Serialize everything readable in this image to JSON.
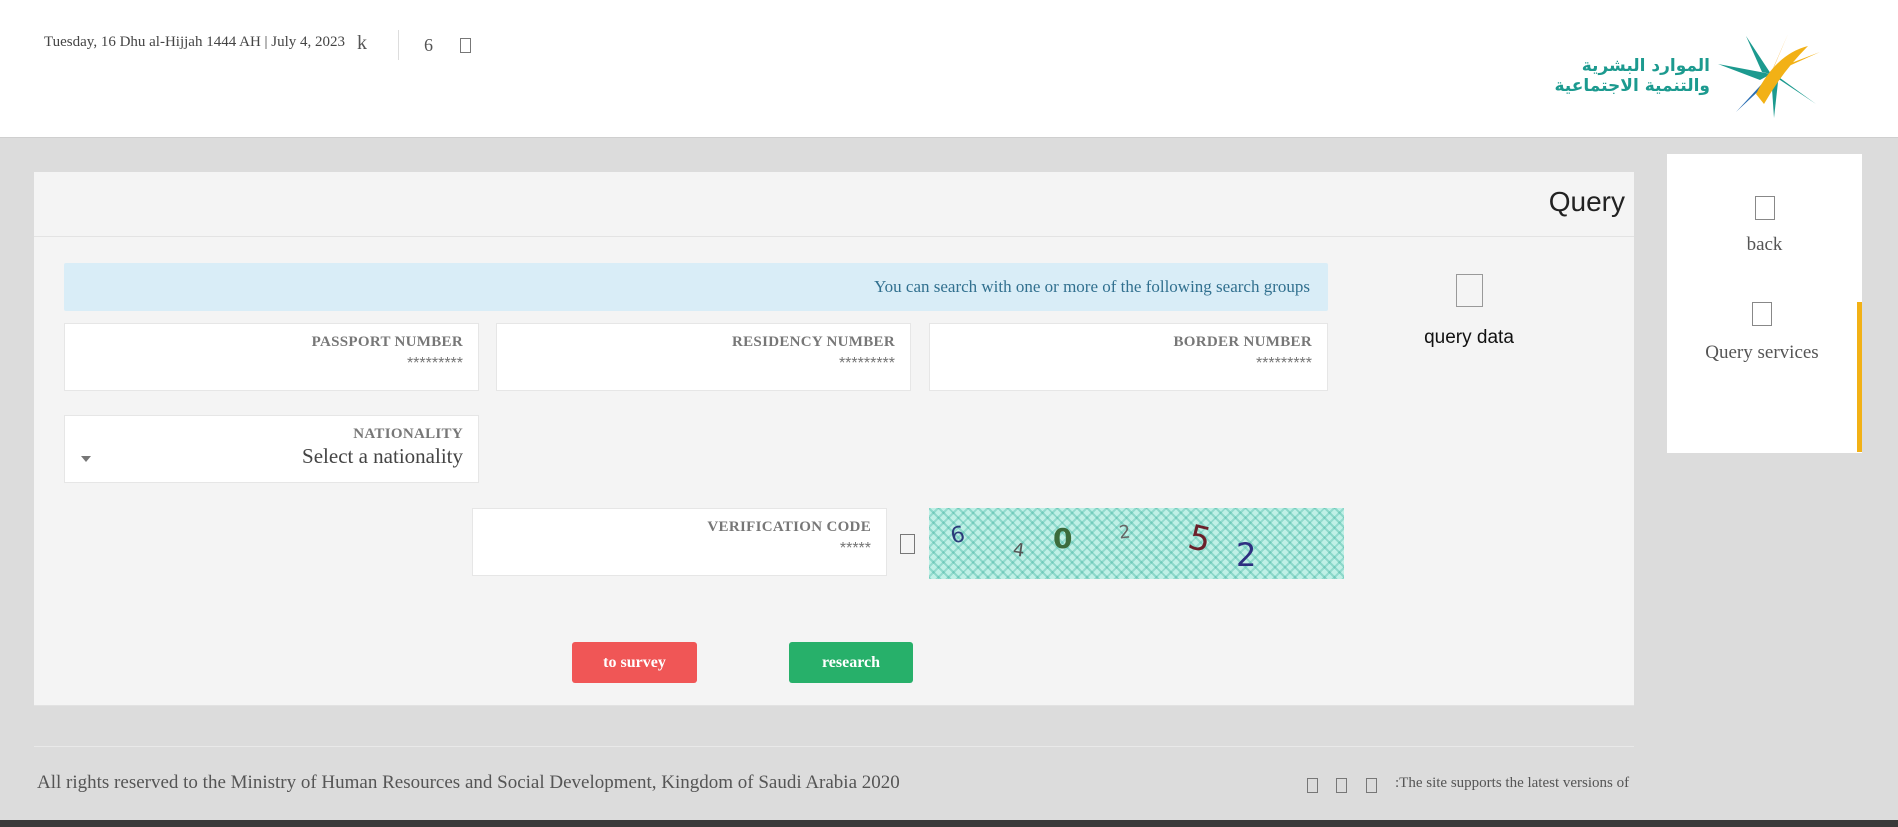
{
  "header": {
    "date": "Tuesday, 16 Dhu al-Hijjah 1444 AH | July 4, 2023",
    "k_label": "k",
    "number": "6",
    "logo_line1": "الموارد البشرية",
    "logo_line2": "والتنمية الاجتماعية"
  },
  "sidenav": {
    "back": "back",
    "query_services": "Query services"
  },
  "panel": {
    "title": "Query",
    "query_data": "query data",
    "info": "You can search with one or more of the following search groups",
    "border": {
      "label": "BORDER NUMBER",
      "placeholder": "*********"
    },
    "residency": {
      "label": "RESIDENCY NUMBER",
      "placeholder": "*********"
    },
    "passport": {
      "label": "PASSPORT NUMBER",
      "placeholder": "*********"
    },
    "nationality": {
      "label": "NATIONALITY",
      "value": "Select a nationality"
    },
    "verification": {
      "label": "VERIFICATION CODE",
      "placeholder": "*****"
    },
    "captcha_digits": [
      "6",
      "4",
      "0",
      "2",
      "5",
      "2"
    ],
    "btn_survey": "to survey",
    "btn_research": "research"
  },
  "colors": {
    "survey_button": "#f05656",
    "research_button": "#27b06a",
    "active_nav_accent": "#f2b116",
    "info_background": "#d9edf7"
  },
  "footer": {
    "copyright": "All rights reserved to the Ministry of Human Resources and Social Development, Kingdom of Saudi Arabia 2020",
    "support": ":The site supports the latest versions of"
  }
}
